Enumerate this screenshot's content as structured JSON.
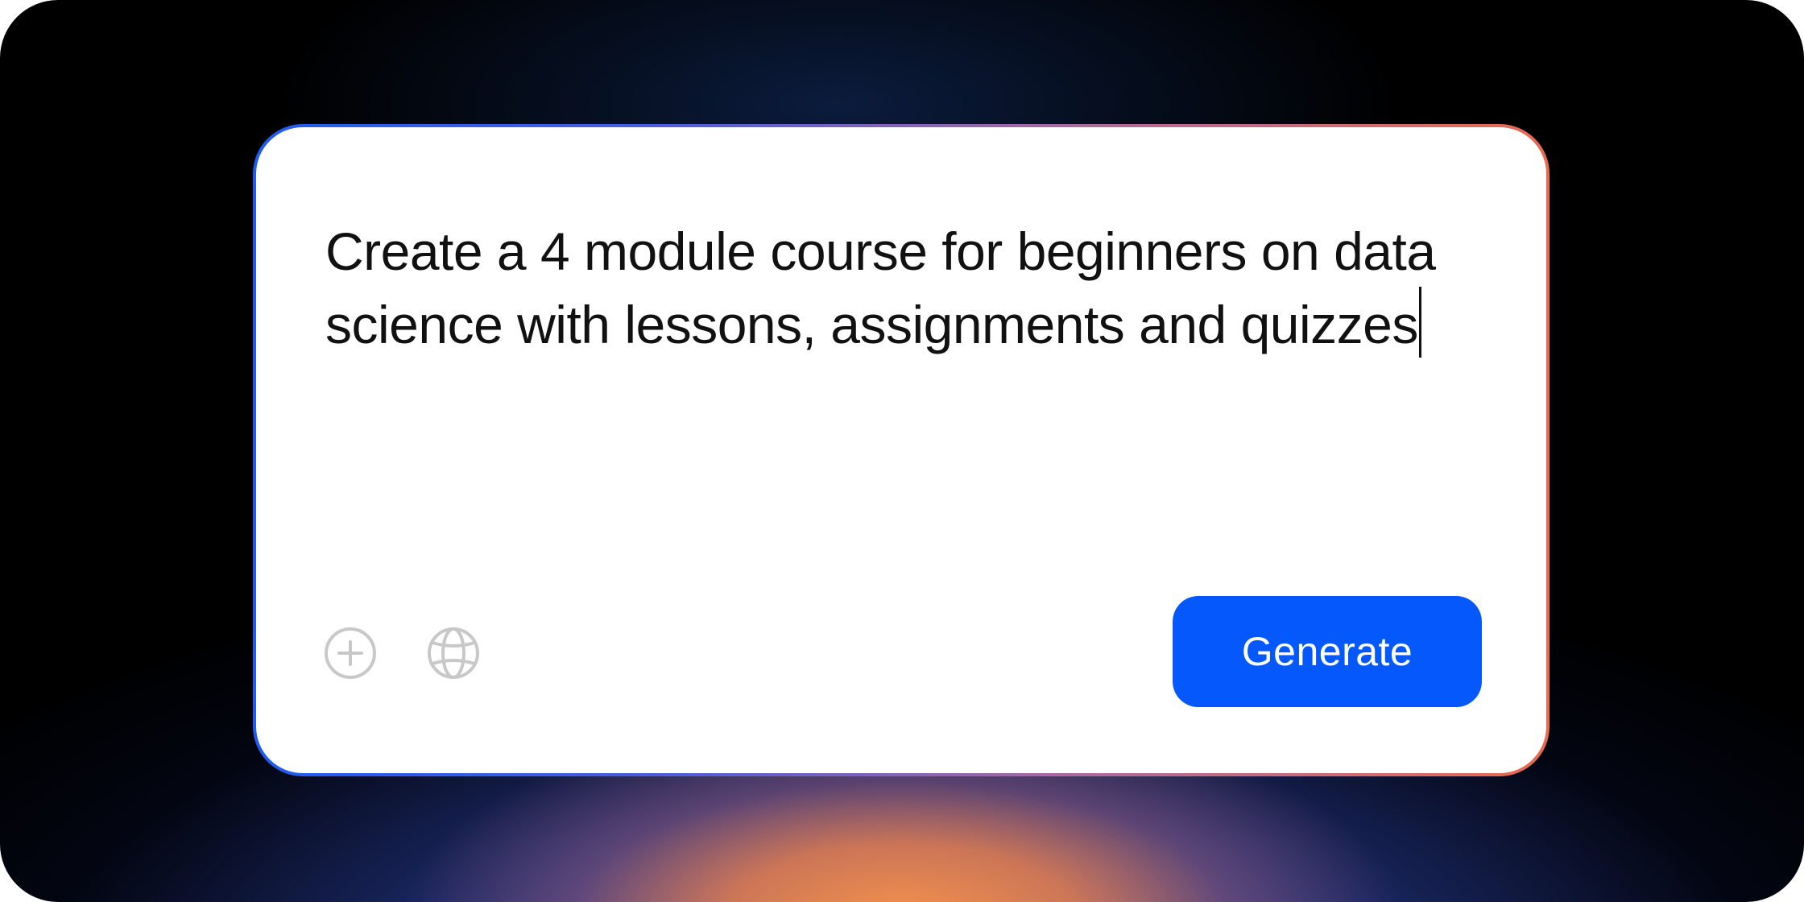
{
  "prompt": {
    "value": "Create a 4 module course for beginners on data science with lessons, assignments and quizzes"
  },
  "toolbar": {
    "add_icon": "plus-circle-icon",
    "web_icon": "globe-icon",
    "generate_label": "Generate"
  },
  "colors": {
    "accent": "#0558fb",
    "icon_gray": "#c8c8c8",
    "border_start": "#1f5cf0",
    "border_end": "#e86a50"
  }
}
